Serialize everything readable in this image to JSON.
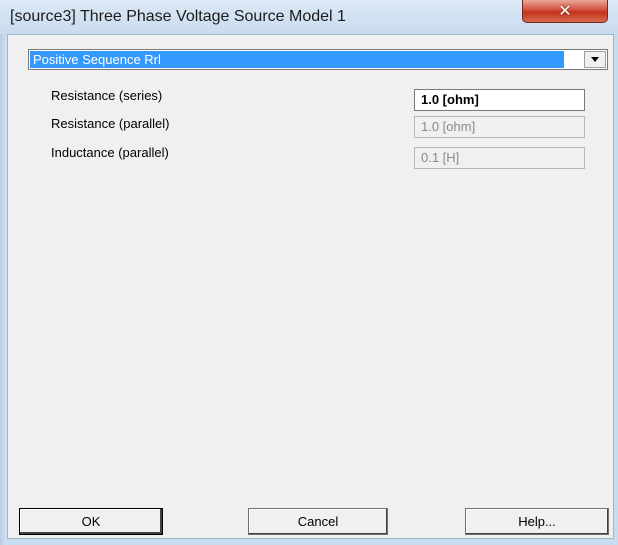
{
  "window": {
    "title": "[source3] Three Phase Voltage Source Model 1",
    "close_icon": "close-x-icon"
  },
  "dropdown": {
    "selected": "Positive Sequence Rrl",
    "arrow_icon": "chevron-down-icon"
  },
  "params": [
    {
      "label": "Resistance (series)",
      "value": "1.0 [ohm]",
      "enabled": true
    },
    {
      "label": "Resistance (parallel)",
      "value": "1.0 [ohm]",
      "enabled": false
    },
    {
      "label": "Inductance (parallel)",
      "value": "0.1 [H]",
      "enabled": false
    }
  ],
  "buttons": {
    "ok": "OK",
    "cancel": "Cancel",
    "help": "Help..."
  },
  "colors": {
    "selection": "#3399ff",
    "close_button": "#c2341c",
    "frame": "#c9dcef"
  }
}
